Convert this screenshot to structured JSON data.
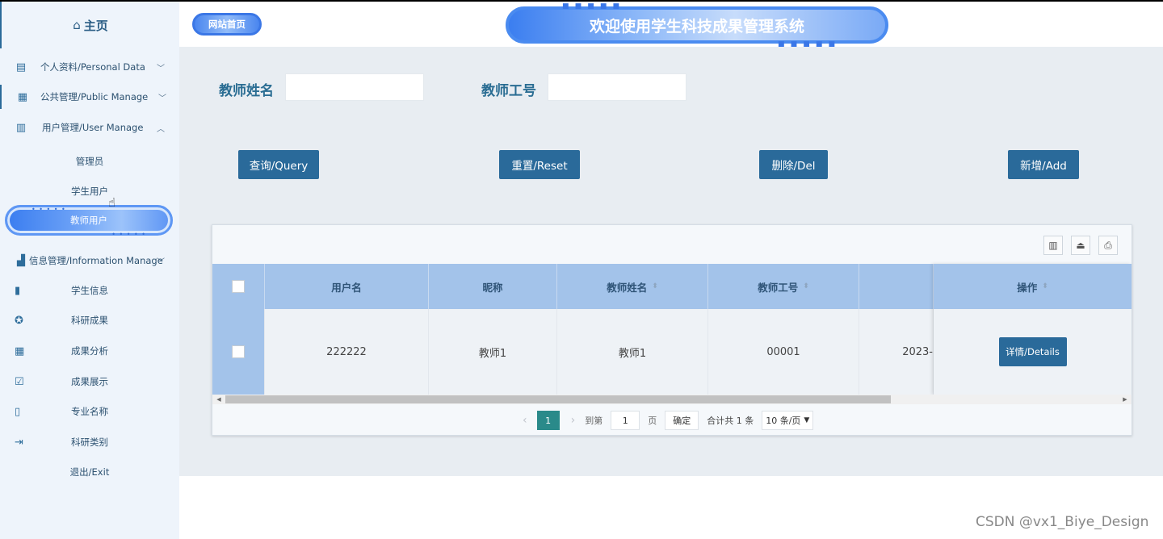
{
  "sidebar": {
    "home_label": "主页",
    "items": [
      {
        "label": "个人资料/Personal Data",
        "icon": "document-icon",
        "chevron": "∨"
      },
      {
        "label": "公共管理/Public Manage",
        "icon": "clipboard-icon",
        "chevron": "∨"
      },
      {
        "label": "用户管理/User Manage",
        "icon": "building-icon",
        "chevron": "∧"
      }
    ],
    "user_sub": [
      {
        "label": "管理员"
      },
      {
        "label": "学生用户"
      },
      {
        "label": "教师用户"
      }
    ],
    "info_manage": {
      "label": "信息管理/Information Manage",
      "icon": "chart-icon",
      "chevron": "∨"
    },
    "info_sub": [
      {
        "label": "学生信息",
        "icon": "bookmark-icon"
      },
      {
        "label": "科研成果",
        "icon": "badge-icon"
      },
      {
        "label": "成果分析",
        "icon": "calendar-icon"
      },
      {
        "label": "成果展示",
        "icon": "calendar-check-icon"
      },
      {
        "label": "专业名称",
        "icon": "book-icon"
      },
      {
        "label": "科研类别",
        "icon": "logout-icon"
      }
    ],
    "exit_label": "退出/Exit"
  },
  "header": {
    "site_home": "网站首页",
    "banner_title": "欢迎使用学生科技成果管理系统"
  },
  "search": {
    "teacher_name_label": "教师姓名",
    "teacher_name_value": "",
    "teacher_id_label": "教师工号",
    "teacher_id_value": ""
  },
  "actions": {
    "query": "查询/Query",
    "reset": "重置/Reset",
    "delete": "删除/Del",
    "add": "新增/Add"
  },
  "table": {
    "headers": [
      "用户名",
      "昵称",
      "教师姓名",
      "教师工号",
      "操作"
    ],
    "rows": [
      {
        "username": "222222",
        "nickname": "教师1",
        "teacher_name": "教师1",
        "teacher_id": "00001",
        "created_partial": "2023-",
        "details": "详情/Details"
      }
    ]
  },
  "pagination": {
    "current_page": "1",
    "goto_label": "到第",
    "goto_value": "1",
    "page_unit": "页",
    "confirm": "确定",
    "total": "合计共 1 条",
    "page_size": "10 条/页"
  },
  "watermark": "CSDN @vx1_Biye_Design"
}
